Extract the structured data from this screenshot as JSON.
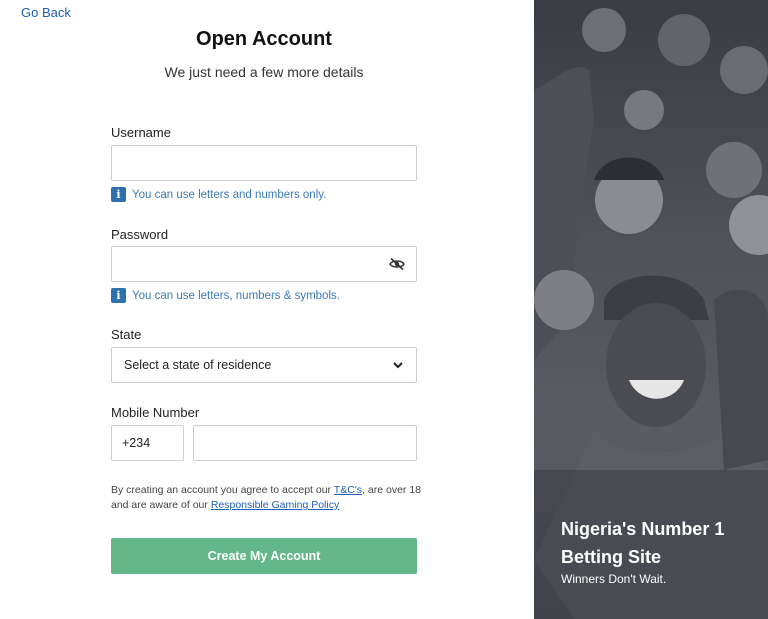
{
  "nav": {
    "go_back": "Go Back"
  },
  "header": {
    "title": "Open Account",
    "subtitle": "We just need a few more details"
  },
  "form": {
    "username": {
      "label": "Username",
      "value": "",
      "placeholder": "",
      "hint": "You can use letters and numbers only."
    },
    "password": {
      "label": "Password",
      "value": "",
      "placeholder": "",
      "hint": "You can use letters, numbers & symbols."
    },
    "state": {
      "label": "State",
      "selected": "Select a state of residence"
    },
    "mobile": {
      "label": "Mobile Number",
      "prefix": "+234",
      "value": "",
      "placeholder": ""
    },
    "terms": {
      "prefix": "By creating an account you agree to accept our ",
      "tc_link": "T&C's",
      "middle": ", are over 18 and are aware of our ",
      "policy_link": "Responsible Gaming Policy"
    },
    "submit_label": "Create My Account"
  },
  "promo": {
    "headline": "Nigeria's Number 1 Betting Site",
    "tagline": "Winners Don't Wait."
  },
  "icons": {
    "info": "info-icon",
    "eye": "eye-slash-icon",
    "chevron": "chevron-down-icon"
  },
  "colors": {
    "link": "#1f5fb8",
    "hint": "#3a7ab8",
    "button": "#63b687",
    "info_badge": "#2e6fae"
  }
}
